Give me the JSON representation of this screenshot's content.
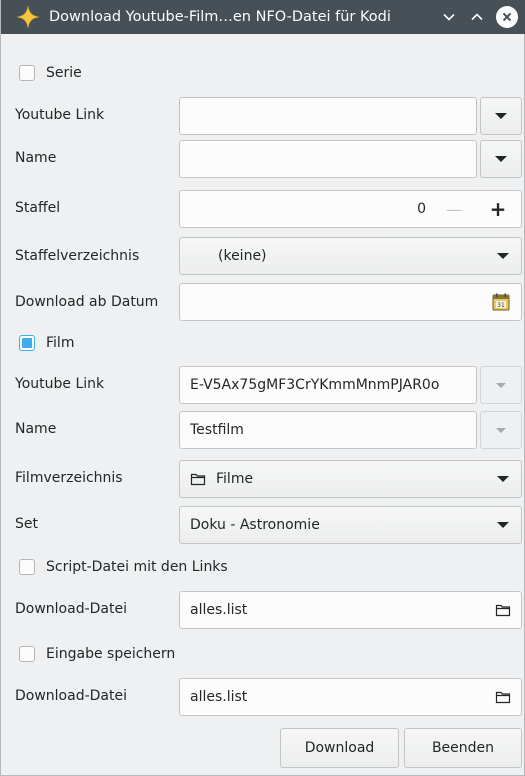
{
  "window": {
    "title": "Download Youtube-Film…en NFO-Datei für Kodi"
  },
  "serie": {
    "checkbox_label": "Serie",
    "checked": false,
    "youtube_link_label": "Youtube Link",
    "youtube_link_value": "",
    "name_label": "Name",
    "name_value": "",
    "staffel_label": "Staffel",
    "staffel_value": "0",
    "staffel_minus": "—",
    "staffel_plus": "+",
    "staffelverzeichnis_label": "Staffelverzeichnis",
    "staffelverzeichnis_value": "(keine)",
    "download_ab_datum_label": "Download ab Datum",
    "download_ab_datum_value": ""
  },
  "film": {
    "checkbox_label": "Film",
    "checked": true,
    "youtube_link_label": "Youtube Link",
    "youtube_link_value": "E-V5Ax75gMF3CrYKmmMnmPJAR0o",
    "name_label": "Name",
    "name_value": "Testfilm",
    "filmverzeichnis_label": "Filmverzeichnis",
    "filmverzeichnis_value": "Filme",
    "set_label": "Set",
    "set_value": "Doku - Astronomie"
  },
  "script": {
    "checkbox_label": "Script-Datei mit den Links",
    "checked": false,
    "download_datei_label": "Download-Datei",
    "download_datei_value": "alles.list"
  },
  "save": {
    "checkbox_label": "Eingabe speichern",
    "checked": false,
    "download_datei_label": "Download-Datei",
    "download_datei_value": "alles.list"
  },
  "buttons": {
    "download": "Download",
    "beenden": "Beenden"
  },
  "colors": {
    "titlebar": "#475057",
    "accent": "#3daee9",
    "window_bg": "#eff0f1"
  },
  "icons": {
    "app": "star-sparkle-icon",
    "minimize": "chevron-down-icon",
    "maximize": "chevron-up-icon",
    "close": "close-icon",
    "calendar": "calendar-icon",
    "folder": "folder-icon"
  }
}
